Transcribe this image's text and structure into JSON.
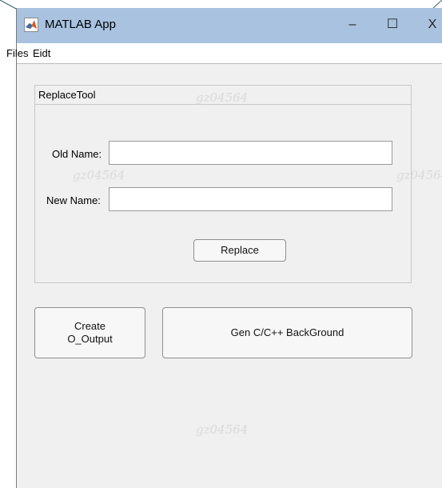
{
  "window": {
    "title": "MATLAB App",
    "icon": "matlab-logo-icon"
  },
  "window_controls": {
    "minimize": "–",
    "maximize": "☐",
    "close": "X"
  },
  "menubar": {
    "items": [
      "Files",
      "Eidt"
    ]
  },
  "panel": {
    "title": "ReplaceTool",
    "old_name_label": "Old Name:",
    "old_name_value": "",
    "new_name_label": "New Name:",
    "new_name_value": "",
    "replace_label": "Replace"
  },
  "buttons": {
    "create_line1": "Create",
    "create_line2": "O_Output",
    "gen_label": "Gen C/C++  BackGround"
  },
  "watermark": "gz04564",
  "colors": {
    "titlebar": "#a8c2e0",
    "window_bg": "#f0f0f0",
    "accent_logo": "#e2571e"
  }
}
